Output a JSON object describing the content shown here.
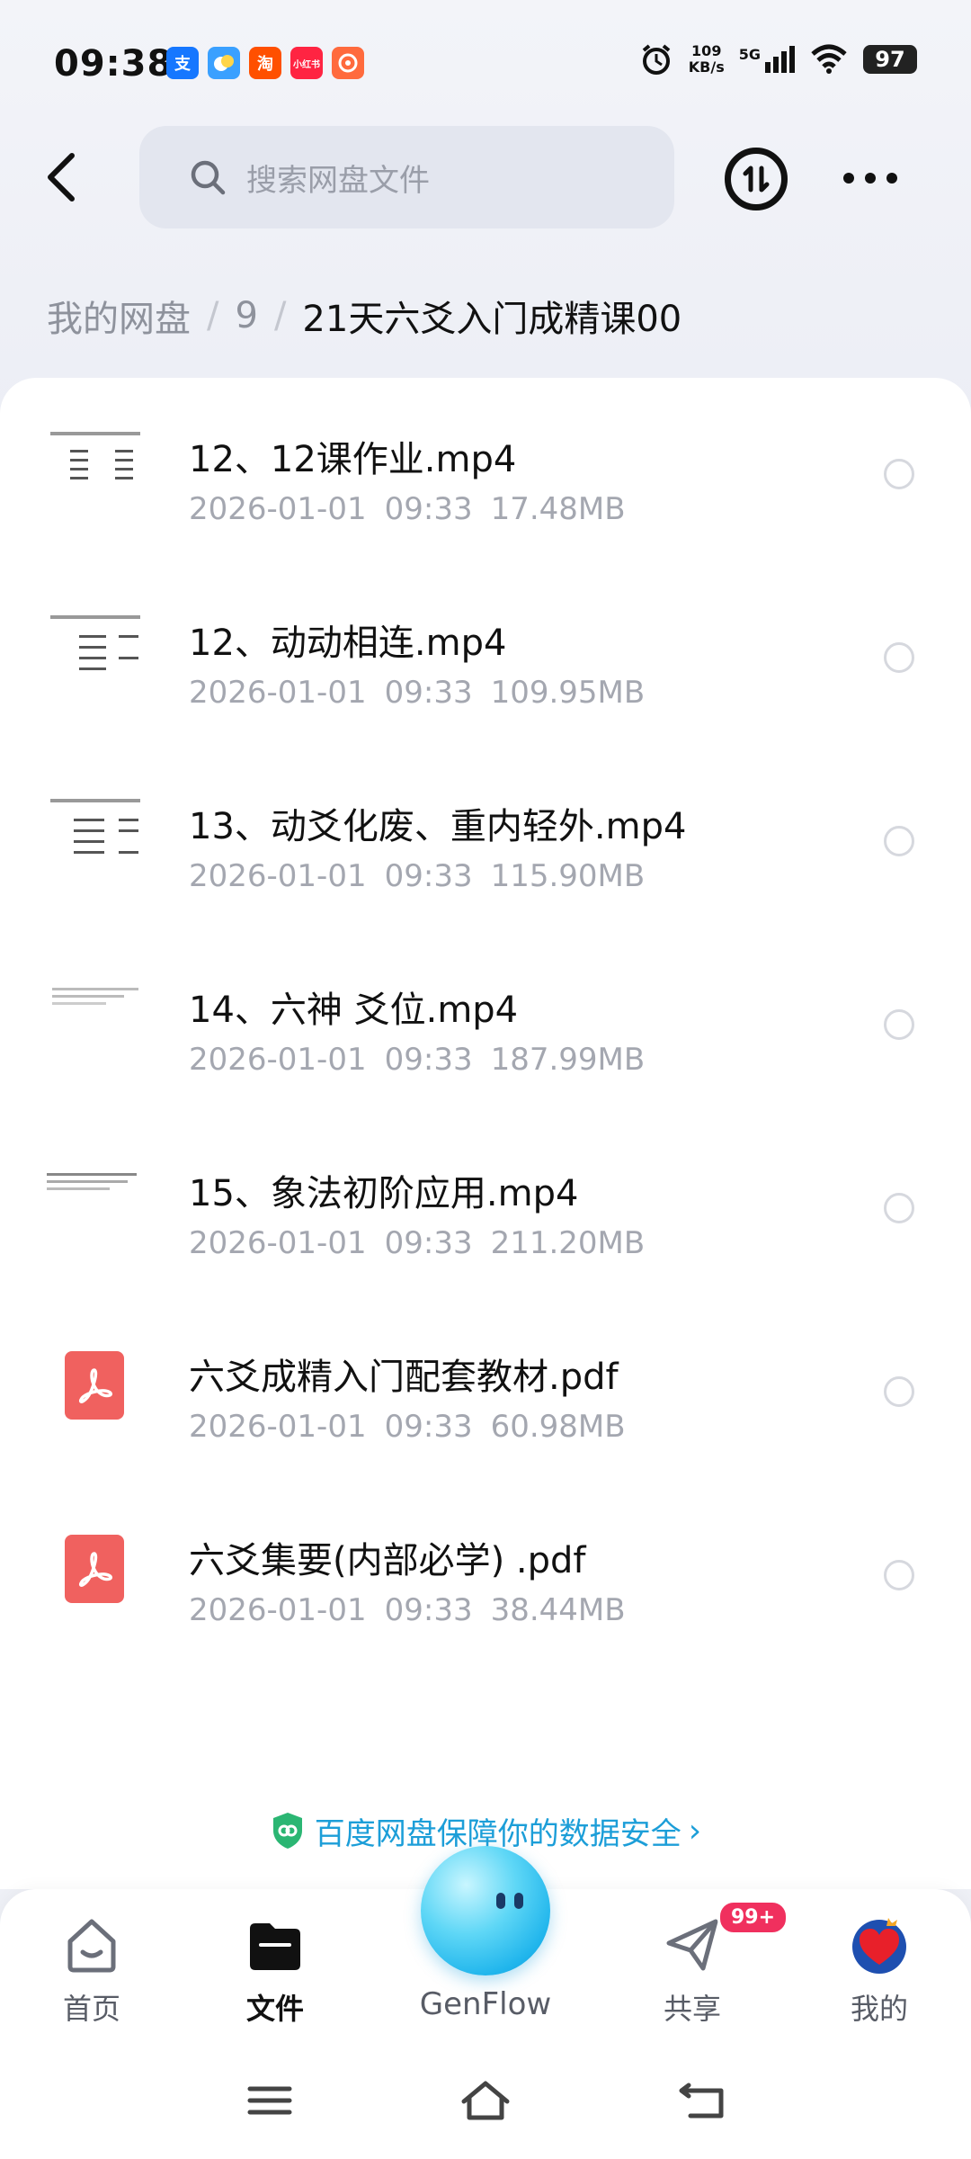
{
  "status_bar": {
    "time": "09:38",
    "app_icons": [
      {
        "name": "alipay-icon",
        "glyph": "支",
        "color": "#1677ff"
      },
      {
        "name": "baidu-netdisk-icon",
        "glyph": "",
        "color": "#3aa0ff"
      },
      {
        "name": "taobao-icon",
        "glyph": "淘",
        "color": "#ff5000"
      },
      {
        "name": "xiaohongshu-icon",
        "glyph": "小红书",
        "color": "#ff2442"
      },
      {
        "name": "app-icon",
        "glyph": "",
        "color": "#ff6a3d"
      }
    ],
    "speed_value": "109",
    "speed_unit": "KB/s",
    "network": "5G",
    "battery": "97"
  },
  "header": {
    "search_placeholder": "搜索网盘文件"
  },
  "breadcrumb": {
    "items": [
      "我的网盘",
      "9"
    ],
    "current": "21天六爻入门成精课00"
  },
  "files": [
    {
      "name": "12、12课作业.mp4",
      "date": "2026-01-01",
      "time": "09:33",
      "size": "17.48MB",
      "type": "video"
    },
    {
      "name": "12、动动相连.mp4",
      "date": "2026-01-01",
      "time": "09:33",
      "size": "109.95MB",
      "type": "video"
    },
    {
      "name": "13、动爻化废、重内轻外.mp4",
      "date": "2026-01-01",
      "time": "09:33",
      "size": "115.90MB",
      "type": "video"
    },
    {
      "name": "14、六神 爻位.mp4",
      "date": "2026-01-01",
      "time": "09:33",
      "size": "187.99MB",
      "type": "video"
    },
    {
      "name": "15、象法初阶应用.mp4",
      "date": "2026-01-01",
      "time": "09:33",
      "size": "211.20MB",
      "type": "video"
    },
    {
      "name": "六爻成精入门配套教材.pdf",
      "date": "2026-01-01",
      "time": "09:33",
      "size": "60.98MB",
      "type": "pdf"
    },
    {
      "name": "六爻集要(内部必学) .pdf",
      "date": "2026-01-01",
      "time": "09:33",
      "size": "38.44MB",
      "type": "pdf"
    }
  ],
  "security_banner": {
    "text": "百度网盘保障你的数据安全"
  },
  "bottom_nav": {
    "home": "首页",
    "files": "文件",
    "genflow": "GenFlow",
    "share": "共享",
    "share_badge": "99+",
    "mine": "我的"
  },
  "colors": {
    "accent": "#1c9ed8",
    "badge": "#f0305e",
    "pdf": "#f0615f"
  }
}
